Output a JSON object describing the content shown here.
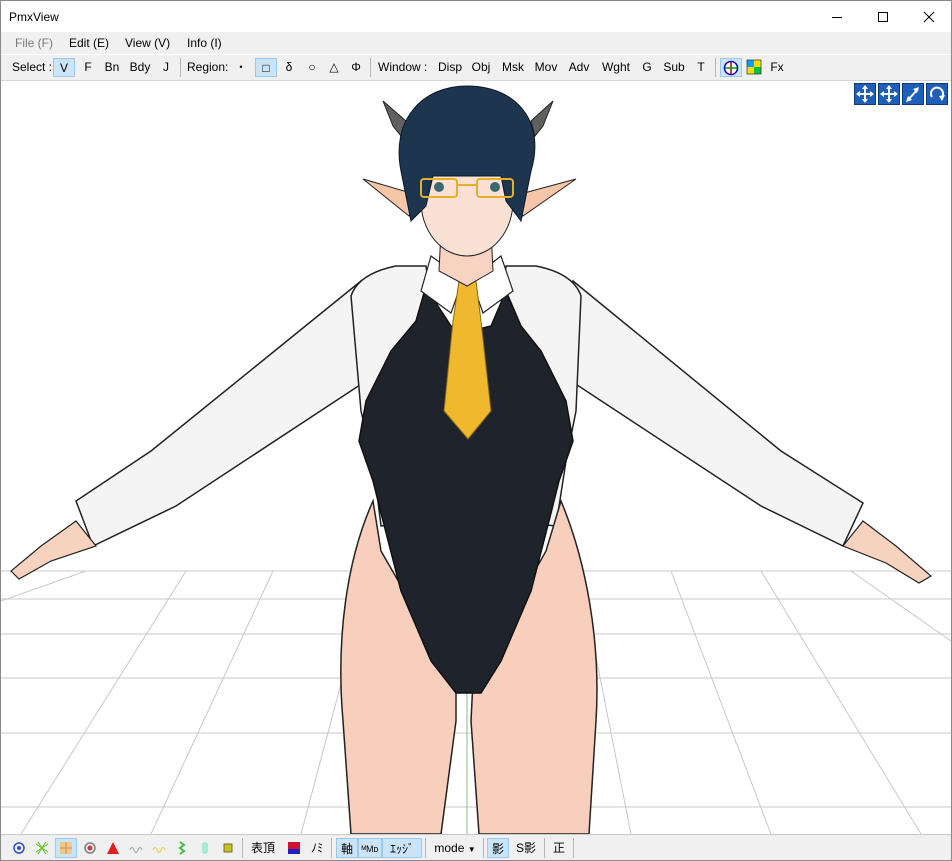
{
  "app": {
    "title": "PmxView"
  },
  "menu": {
    "file": "File (F)",
    "edit": "Edit (E)",
    "view": "View (V)",
    "info": "Info (I)"
  },
  "toolbar": {
    "select_label": "Select :",
    "select_items": [
      "V",
      "F",
      "Bn",
      "Bdy",
      "J"
    ],
    "region_label": "Region:",
    "region_items": [
      "・",
      "□",
      "δ",
      "○",
      "△",
      "Φ"
    ],
    "window_label": "Window :",
    "window_items": [
      "Disp",
      "Obj",
      "Msk",
      "Mov",
      "Adv",
      "Wght",
      "G",
      "Sub",
      "T"
    ],
    "fx_label": "Fx"
  },
  "statusbar": {
    "expr_vertex": "表頂",
    "nomi": "ﾉﾐ",
    "axis": "軸",
    "mb": "ᴹMᴅ",
    "edge": "ｴｯｼﾞ",
    "mode": "mode",
    "shadow": "影",
    "s_shadow": "S影",
    "ortho": "正"
  },
  "colors": {
    "accent": "#1f5fb8",
    "toggle_on": "#cce4f7"
  }
}
